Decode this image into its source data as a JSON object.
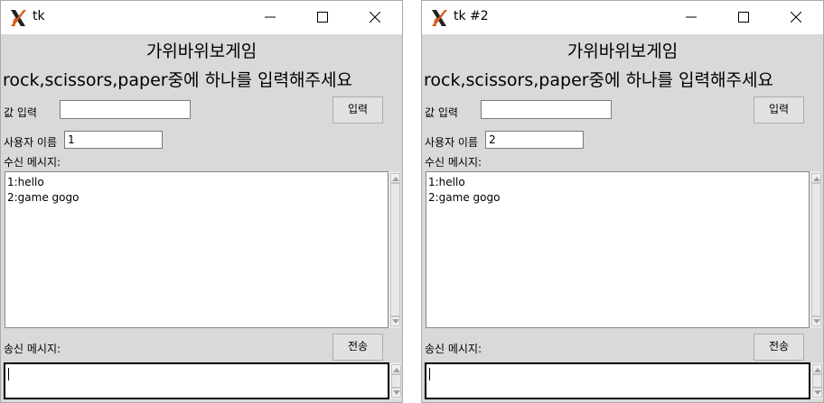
{
  "windows": [
    {
      "title": "tk",
      "heading": "가위바위보게임",
      "prompt": "rock,scissors,paper중에 하나를 입력해주세요",
      "value_label": "값 입력",
      "value_input": "",
      "input_button": "입력",
      "username_label": "사용자 이름",
      "username_value": "1",
      "received_label": "수신 메시지:",
      "received_messages": [
        "1:hello",
        "2:game gogo"
      ],
      "send_label": "송신 메시지:",
      "send_button": "전송",
      "send_text": ""
    },
    {
      "title": "tk #2",
      "heading": "가위바위보게임",
      "prompt": "rock,scissors,paper중에 하나를 입력해주세요",
      "value_label": "값 입력",
      "value_input": "",
      "input_button": "입력",
      "username_label": "사용자 이름",
      "username_value": "2",
      "received_label": "수신 메시지:",
      "received_messages": [
        "1:hello",
        "2:game gogo"
      ],
      "send_label": "송신 메시지:",
      "send_button": "전송",
      "send_text": ""
    }
  ]
}
